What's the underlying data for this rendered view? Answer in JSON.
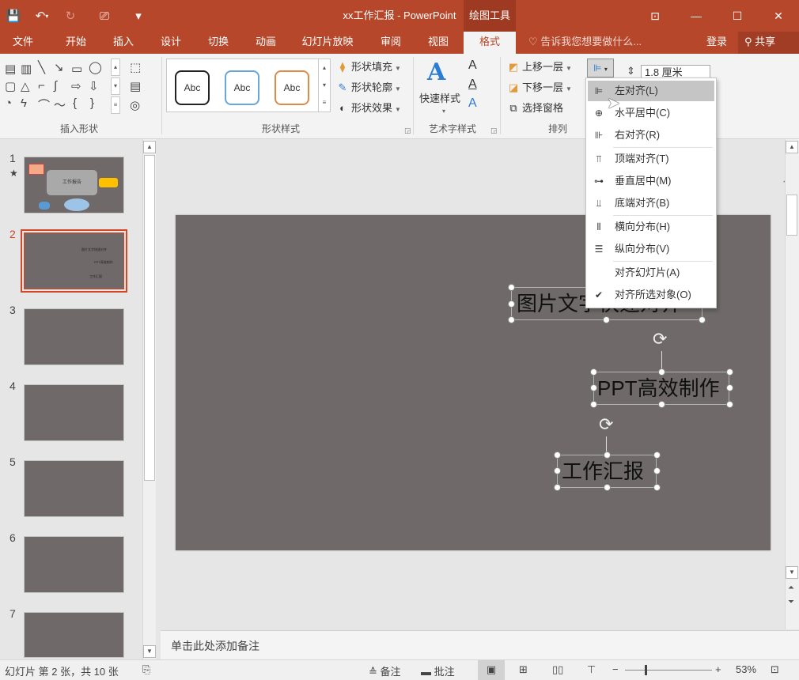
{
  "window": {
    "title": "xx工作汇报 - PowerPoint",
    "context_tab": "绘图工具",
    "min": "—",
    "restore": "☐",
    "close": "✕"
  },
  "tabs": [
    "文件",
    "开始",
    "插入",
    "设计",
    "切换",
    "动画",
    "幻灯片放映",
    "审阅",
    "视图",
    "格式"
  ],
  "active_tab": "格式",
  "tell_me": "告诉我您想要做什么...",
  "account": {
    "login": "登录",
    "share": "共享"
  },
  "ribbon": {
    "groups": {
      "insert_shapes": "插入形状",
      "shape_styles": "形状样式",
      "wordart_styles": "艺术字样式",
      "arrange": "排列"
    },
    "style_gallery": [
      "Abc",
      "Abc",
      "Abc"
    ],
    "shape_fill": "形状填充",
    "shape_outline": "形状轮廓",
    "shape_effects": "形状效果",
    "quick_styles": "快速样式",
    "bring_forward": "上移一层",
    "send_backward": "下移一层",
    "selection_pane": "选择窗格",
    "size_value": "1.8 厘米"
  },
  "align_menu": {
    "items": [
      {
        "label": "左对齐(L)",
        "icon": "align-left-icon"
      },
      {
        "label": "水平居中(C)",
        "icon": "align-center-icon"
      },
      {
        "label": "右对齐(R)",
        "icon": "align-right-icon"
      },
      {
        "label": "顶端对齐(T)",
        "icon": "align-top-icon"
      },
      {
        "label": "垂直居中(M)",
        "icon": "align-middle-icon"
      },
      {
        "label": "底端对齐(B)",
        "icon": "align-bottom-icon"
      },
      {
        "label": "横向分布(H)",
        "icon": "distribute-horizontal-icon"
      },
      {
        "label": "纵向分布(V)",
        "icon": "distribute-vertical-icon"
      },
      {
        "label": "对齐幻灯片(A)",
        "icon": ""
      },
      {
        "label": "对齐所选对象(O)",
        "icon": "checkmark-icon"
      }
    ],
    "hovered": "左对齐(L)"
  },
  "thumbnails": {
    "numbers": [
      "1",
      "2",
      "3",
      "4",
      "5",
      "6",
      "7"
    ],
    "selected": "2",
    "slide1_title": "工作报告",
    "slide2_lines": [
      "图片文字快速对齐",
      "PPT高效制作",
      "工作汇报"
    ]
  },
  "slide": {
    "texts": [
      "图片文字快速对齐",
      "PPT高效制作",
      "工作汇报"
    ],
    "background": "#6f6a69"
  },
  "notes_placeholder": "单击此处添加备注",
  "status": {
    "slide_info": "幻灯片 第 2 张，共 10 张",
    "notes": "备注",
    "comments": "批注",
    "zoom": "53%"
  },
  "colors": {
    "accent": "#b7472a",
    "selected": "#d24726"
  }
}
